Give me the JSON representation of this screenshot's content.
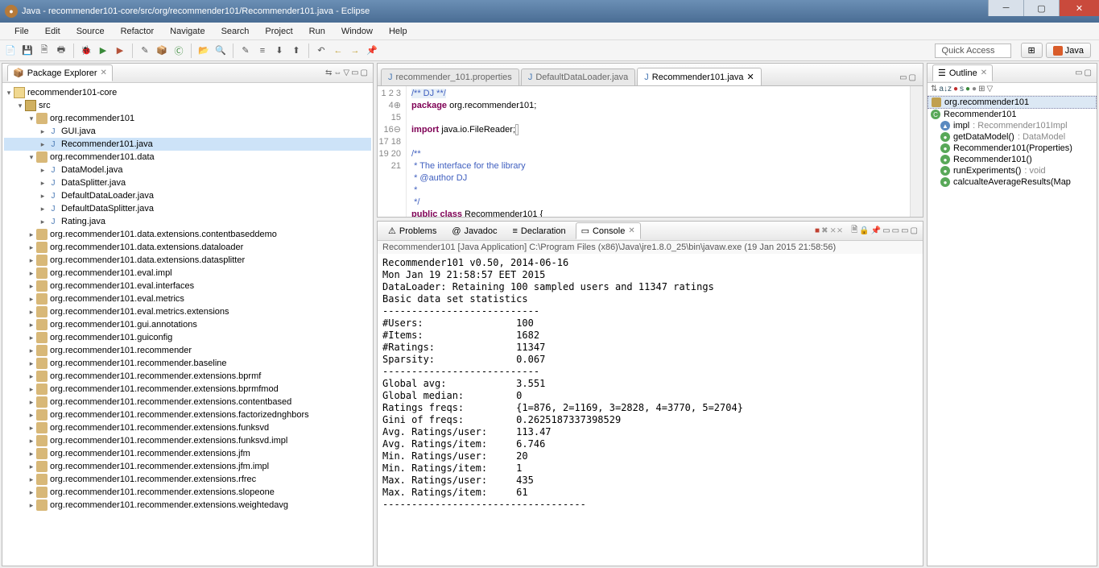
{
  "title": "Java - recommender101-core/src/org/recommender101/Recommender101.java - Eclipse",
  "menu": [
    "File",
    "Edit",
    "Source",
    "Refactor",
    "Navigate",
    "Search",
    "Project",
    "Run",
    "Window",
    "Help"
  ],
  "quick_access": "Quick Access",
  "perspective": "Java",
  "package_explorer": {
    "title": "Package Explorer",
    "project": "recommender101-core",
    "src": "src",
    "pkg1": "org.recommender101",
    "files1": [
      "GUI.java",
      "Recommender101.java"
    ],
    "pkg2": "org.recommender101.data",
    "files2": [
      "DataModel.java",
      "DataSplitter.java",
      "DefaultDataLoader.java",
      "DefaultDataSplitter.java",
      "Rating.java"
    ],
    "other_pkgs": [
      "org.recommender101.data.extensions.contentbaseddemo",
      "org.recommender101.data.extensions.dataloader",
      "org.recommender101.data.extensions.datasplitter",
      "org.recommender101.eval.impl",
      "org.recommender101.eval.interfaces",
      "org.recommender101.eval.metrics",
      "org.recommender101.eval.metrics.extensions",
      "org.recommender101.gui.annotations",
      "org.recommender101.guiconfig",
      "org.recommender101.recommender",
      "org.recommender101.recommender.baseline",
      "org.recommender101.recommender.extensions.bprmf",
      "org.recommender101.recommender.extensions.bprmfmod",
      "org.recommender101.recommender.extensions.contentbased",
      "org.recommender101.recommender.extensions.factorizednghbors",
      "org.recommender101.recommender.extensions.funksvd",
      "org.recommender101.recommender.extensions.funksvd.impl",
      "org.recommender101.recommender.extensions.jfm",
      "org.recommender101.recommender.extensions.jfm.impl",
      "org.recommender101.recommender.extensions.rfrec",
      "org.recommender101.recommender.extensions.slopeone",
      "org.recommender101.recommender.extensions.weightedavg"
    ]
  },
  "editor": {
    "tabs": [
      {
        "label": "recommender_101.properties",
        "active": false
      },
      {
        "label": "DefaultDataLoader.java",
        "active": false
      },
      {
        "label": "Recommender101.java",
        "active": true
      }
    ],
    "lines": [
      "1",
      "2",
      "3",
      "4",
      "15",
      "16",
      "17",
      "18",
      "19",
      "20",
      "21"
    ],
    "code_raw": "/** DJ **/\npackage org.recommender101;\n\nimport java.io.FileReader;\n\n/**\n * The interface for the library\n * @author DJ\n *\n */\npublic class Recommender101 {"
  },
  "bottom": {
    "tabs": [
      "Problems",
      "Javadoc",
      "Declaration",
      "Console"
    ],
    "launch": "Recommender101 [Java Application] C:\\Program Files (x86)\\Java\\jre1.8.0_25\\bin\\javaw.exe (19 Jan 2015 21:58:56)",
    "output": "Recommender101 v0.50, 2014-06-16\nMon Jan 19 21:58:57 EET 2015\nDataLoader: Retaining 100 sampled users and 11347 ratings\nBasic data set statistics\n---------------------------\n#Users:                100\n#Items:                1682\n#Ratings:              11347\nSparsity:              0.067\n---------------------------\nGlobal avg:            3.551\nGlobal median:         0\nRatings freqs:         {1=876, 2=1169, 3=2828, 4=3770, 5=2704}\nGini of freqs:         0.2625187337398529\nAvg. Ratings/user:     113.47\nAvg. Ratings/item:     6.746\nMin. Ratings/user:     20\nMin. Ratings/item:     1\nMax. Ratings/user:     435\nMax. Ratings/item:     61\n-----------------------------------"
  },
  "outline": {
    "title": "Outline",
    "pkg": "org.recommender101",
    "cls": "Recommender101",
    "members": [
      {
        "k": "field",
        "name": "impl",
        "sig": ": Recommender101Impl"
      },
      {
        "k": "meth",
        "name": "getDataModel()",
        "sig": ": DataModel"
      },
      {
        "k": "meth",
        "name": "Recommender101(Properties)",
        "sig": ""
      },
      {
        "k": "meth",
        "name": "Recommender101()",
        "sig": ""
      },
      {
        "k": "meth",
        "name": "runExperiments()",
        "sig": ": void"
      },
      {
        "k": "meth",
        "name": "calcualteAverageResults(Map",
        "sig": ""
      }
    ]
  }
}
